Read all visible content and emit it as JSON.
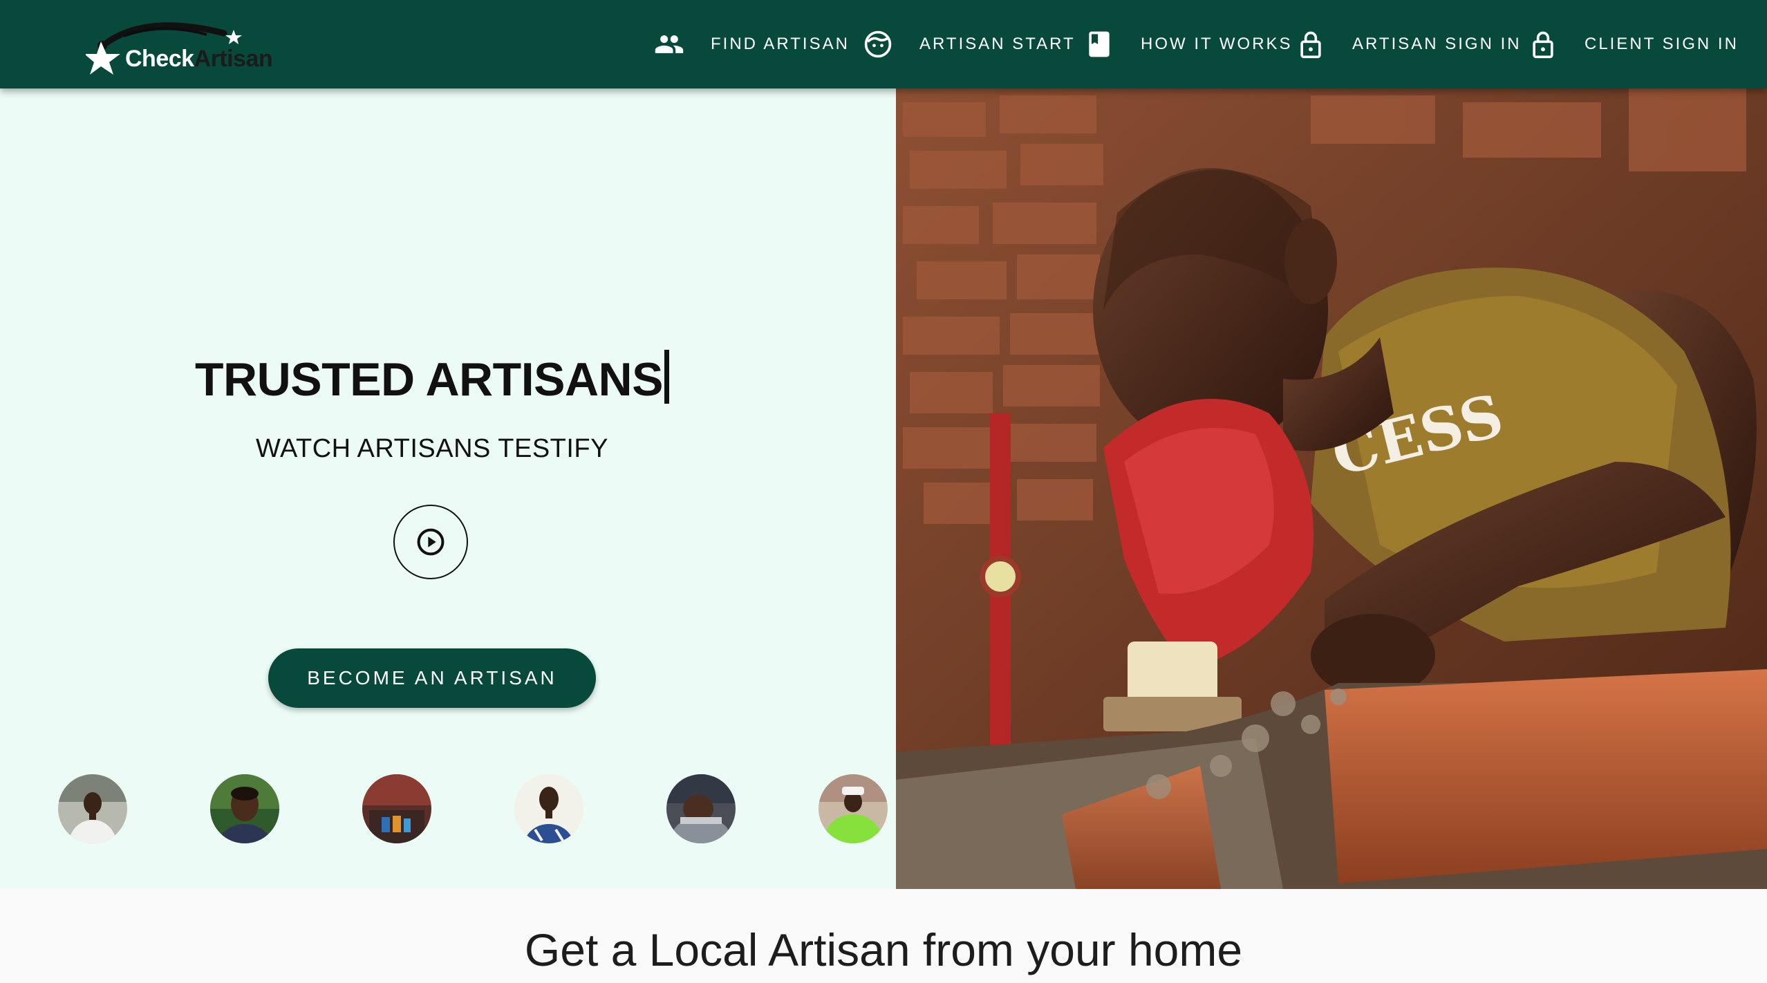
{
  "brand": {
    "logo_word_1": "Check",
    "logo_word_2": "Artisan"
  },
  "nav": [
    {
      "label": "FIND ARTISAN",
      "icon": "people-icon"
    },
    {
      "label": "ARTISAN START",
      "icon": "face-icon"
    },
    {
      "label": "HOW IT WORKS",
      "icon": "book-icon"
    },
    {
      "label": "ARTISAN SIGN IN",
      "icon": "lock-icon"
    },
    {
      "label": "CLIENT SIGN IN",
      "icon": "lock-icon"
    }
  ],
  "hero": {
    "headline": "TRUSTED ARTISANS",
    "subhead": "WATCH ARTISANS TESTIFY",
    "cta_label": "BECOME AN ARTISAN",
    "avatar_count": 6
  },
  "section": {
    "title": "Get a Local Artisan from your home"
  },
  "colors": {
    "primary": "#074a3c",
    "hero_bg": "#ecfbf5",
    "page_bg": "#fafafa"
  }
}
